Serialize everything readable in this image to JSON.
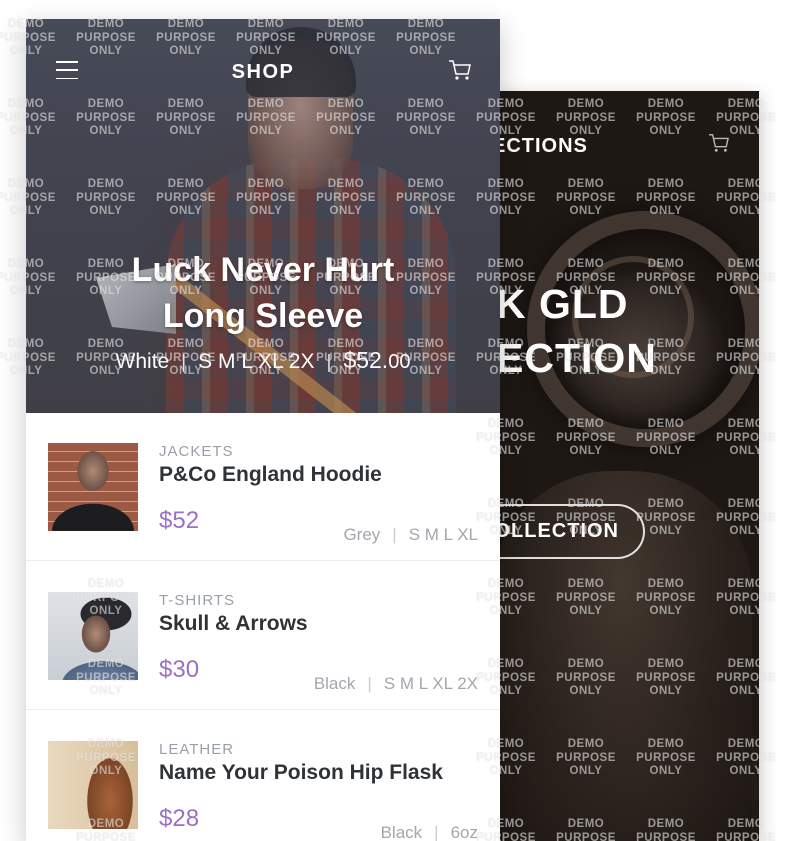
{
  "back_screen": {
    "nav_title": "ECTIONS",
    "headline_line1": "K GLD",
    "headline_line2": "ECTION",
    "cta_label": "OLLECTION"
  },
  "front_screen": {
    "nav_title": "SHOP",
    "hero": {
      "title_line1": "Luck Never Hurt",
      "title_line2": "Long Sleeve",
      "color": "White",
      "separator": "|",
      "sizes": "S M L XL 2X",
      "price_main": "$52.",
      "price_cents": "00"
    },
    "products": [
      {
        "category": "JACKETS",
        "name": "P&Co England Hoodie",
        "price": "$52",
        "color": "Grey",
        "separator": "|",
        "sizes": "S M L XL"
      },
      {
        "category": "T-SHIRTS",
        "name": "Skull & Arrows",
        "price": "$30",
        "color": "Black",
        "separator": "|",
        "sizes": "S M L XL 2X"
      },
      {
        "category": "LEATHER",
        "name": "Name Your Poison Hip Flask",
        "price": "$28",
        "color": "Black",
        "separator": "|",
        "sizes": "6oz"
      }
    ]
  },
  "watermark": {
    "line1": "DEMO",
    "line2": "PURPOSE",
    "line3": "ONLY"
  },
  "colors": {
    "accent_price": "#9b6fc3",
    "text_dark": "#2f3338",
    "text_muted": "#9aa0a8"
  }
}
